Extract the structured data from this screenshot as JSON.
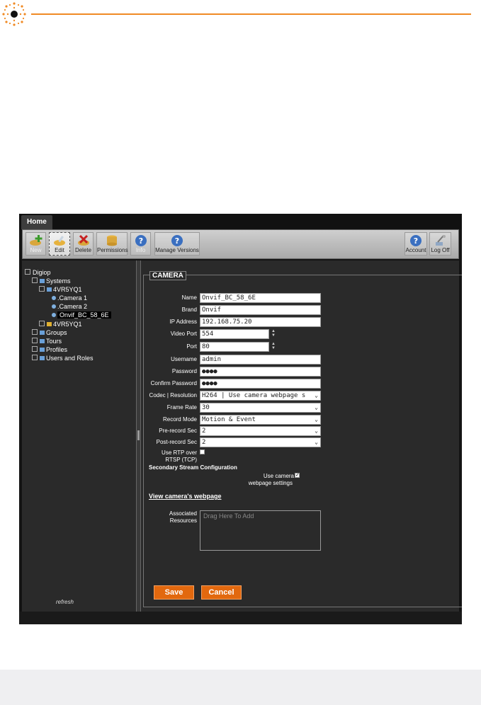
{
  "app": {
    "tab": "Home",
    "toolbar": {
      "new": "New",
      "edit": "Edit",
      "delete": "Delete",
      "permissions": "Permissions",
      "info": "Info",
      "manage_versions": "Manage Versions",
      "account": "Account",
      "log_off": "Log Off"
    },
    "tree": {
      "root": "Digiop",
      "systems": "Systems",
      "system1": "4VR5YQ1",
      "camera1": ".Camera 1",
      "camera2": ".Camera 2",
      "camera3": "Onvif_BC_58_6E",
      "system2": "4VR5YQ1",
      "groups": "Groups",
      "tours": "Tours",
      "profiles": "Profiles",
      "users": "Users and Roles",
      "refresh": "refresh"
    },
    "form": {
      "legend": "CAMERA",
      "name_label": "Name",
      "name_value": "Onvif_BC_58_6E",
      "brand_label": "Brand",
      "brand_value": "Onvif",
      "ip_label": "IP Address",
      "ip_value": "192.168.75.20",
      "video_port_label": "Video Port",
      "video_port_value": "554",
      "port_label": "Port",
      "port_value": "80",
      "username_label": "Username",
      "username_value": "admin",
      "password_label": "Password",
      "password_value": "●●●●",
      "confirm_label": "Confirm Password",
      "confirm_value": "●●●●",
      "codec_label": "Codec | Resolution",
      "codec_value": "H264 | Use camera webpage s",
      "frame_rate_label": "Frame Rate",
      "frame_rate_value": "30",
      "record_mode_label": "Record Mode",
      "record_mode_value": "Motion & Event",
      "pre_record_label": "Pre-record Sec",
      "pre_record_value": "2",
      "post_record_label": "Post-record Sec",
      "post_record_value": "2",
      "rtp_label_1": "Use RTP over",
      "rtp_label_2": "RTSP (TCP)",
      "secondary_head": "Secondary Stream Configuration",
      "use_camera_1": "Use camera",
      "use_camera_2": "webpage settings",
      "view_webpage": "View camera's webpage",
      "assoc_label_1": "Associated",
      "assoc_label_2": "Resources",
      "assoc_placeholder": "Drag Here To Add",
      "save": "Save",
      "cancel": "Cancel"
    }
  },
  "colors": {
    "accent_orange": "#f08a24",
    "button_orange": "#e2680e",
    "panel_bg": "#2a2a2a"
  }
}
